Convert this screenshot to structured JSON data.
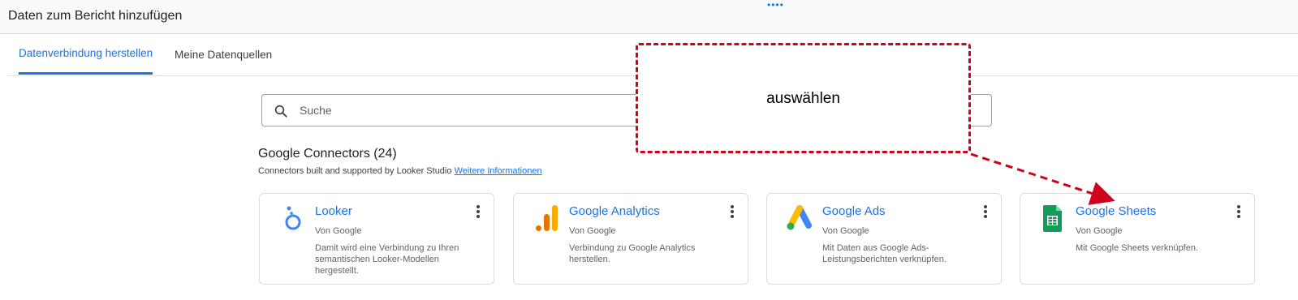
{
  "dialog": {
    "title": "Daten zum Bericht hinzufügen"
  },
  "tabs": [
    {
      "label": "Datenverbindung herstellen",
      "active": true
    },
    {
      "label": "Meine Datenquellen",
      "active": false
    }
  ],
  "search": {
    "placeholder": "Suche",
    "icon": "search-icon"
  },
  "section": {
    "title": "Google Connectors (24)",
    "subtitle": "Connectors built and supported by Looker Studio",
    "link": "Weitere Informationen"
  },
  "connectors": [
    {
      "name": "Looker",
      "by": "Von Google",
      "desc": "Damit wird eine Verbindung zu Ihren semantischen Looker-Modellen hergestellt.",
      "icon": "looker-icon"
    },
    {
      "name": "Google Analytics",
      "by": "Von Google",
      "desc": "Verbindung zu Google Analytics herstellen.",
      "icon": "google-analytics-icon"
    },
    {
      "name": "Google Ads",
      "by": "Von Google",
      "desc": "Mit Daten aus Google Ads-Leistungsberichten verknüpfen.",
      "icon": "google-ads-icon"
    },
    {
      "name": "Google Sheets",
      "by": "Von Google",
      "desc": "Mit Google Sheets verknüpfen.",
      "icon": "google-sheets-icon"
    }
  ],
  "annotation": {
    "text": "auswählen",
    "color": "#d0021b"
  },
  "colors": {
    "accent": "#1a73e8",
    "annotation": "#d0021b"
  }
}
